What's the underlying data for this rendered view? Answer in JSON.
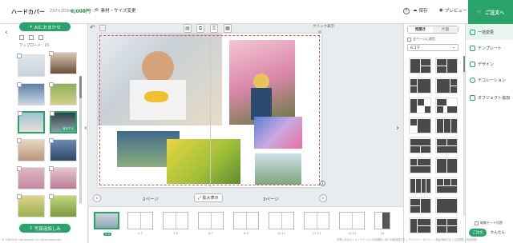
{
  "header": {
    "title": "ハードカバー",
    "spec": "297×203mm・16ページ",
    "price": "6,000円",
    "change_label": "素材・サイズ変更",
    "save_label": "保存",
    "preview_label": "プレビュー",
    "order_label": "ご注文へ"
  },
  "left_panel": {
    "auto_button": "AIにおまかせ",
    "upload_info": "アップロード：25",
    "thumbnail_badge": "追加する",
    "upload_button": "写真追加しみ",
    "copyright": "© FUJIFILM Corporation All rights reserved."
  },
  "canvas": {
    "click_hint": "クリック表示",
    "left_page_label": "2ページ",
    "right_page_label": "3ページ",
    "zoom_label": "拡大表示",
    "page_number": "1"
  },
  "filmstrip": {
    "pages": [
      "表紙",
      "2-3",
      "4-5",
      "6-7",
      "8-9",
      "10-11",
      "12-13",
      "14-15",
      "16"
    ],
    "active_tag": "2-3"
  },
  "layout_panel": {
    "tabs": [
      "見開き",
      "片面"
    ],
    "apply_all": "全ページに適用",
    "koma_value": "6コマ"
  },
  "nav": {
    "items": [
      "一括変更",
      "テンプレート",
      "デザイン",
      "デコレーション",
      "オブジェクト追加"
    ],
    "edit_mode": "編集モード切替",
    "finish_label": "ご注文",
    "easy_label": "かんたん"
  },
  "footer": {
    "links": "お問い合わせ | メンテナンス | 利用規約 | 個人情報保護方針 | プライバシーポリシー | 特定商取引法 | 注文履歴 | 商品詳細"
  },
  "colors": {
    "accent": "#2aa36b",
    "bleed": "#e25555",
    "layout_block": "#4a4a4a"
  }
}
